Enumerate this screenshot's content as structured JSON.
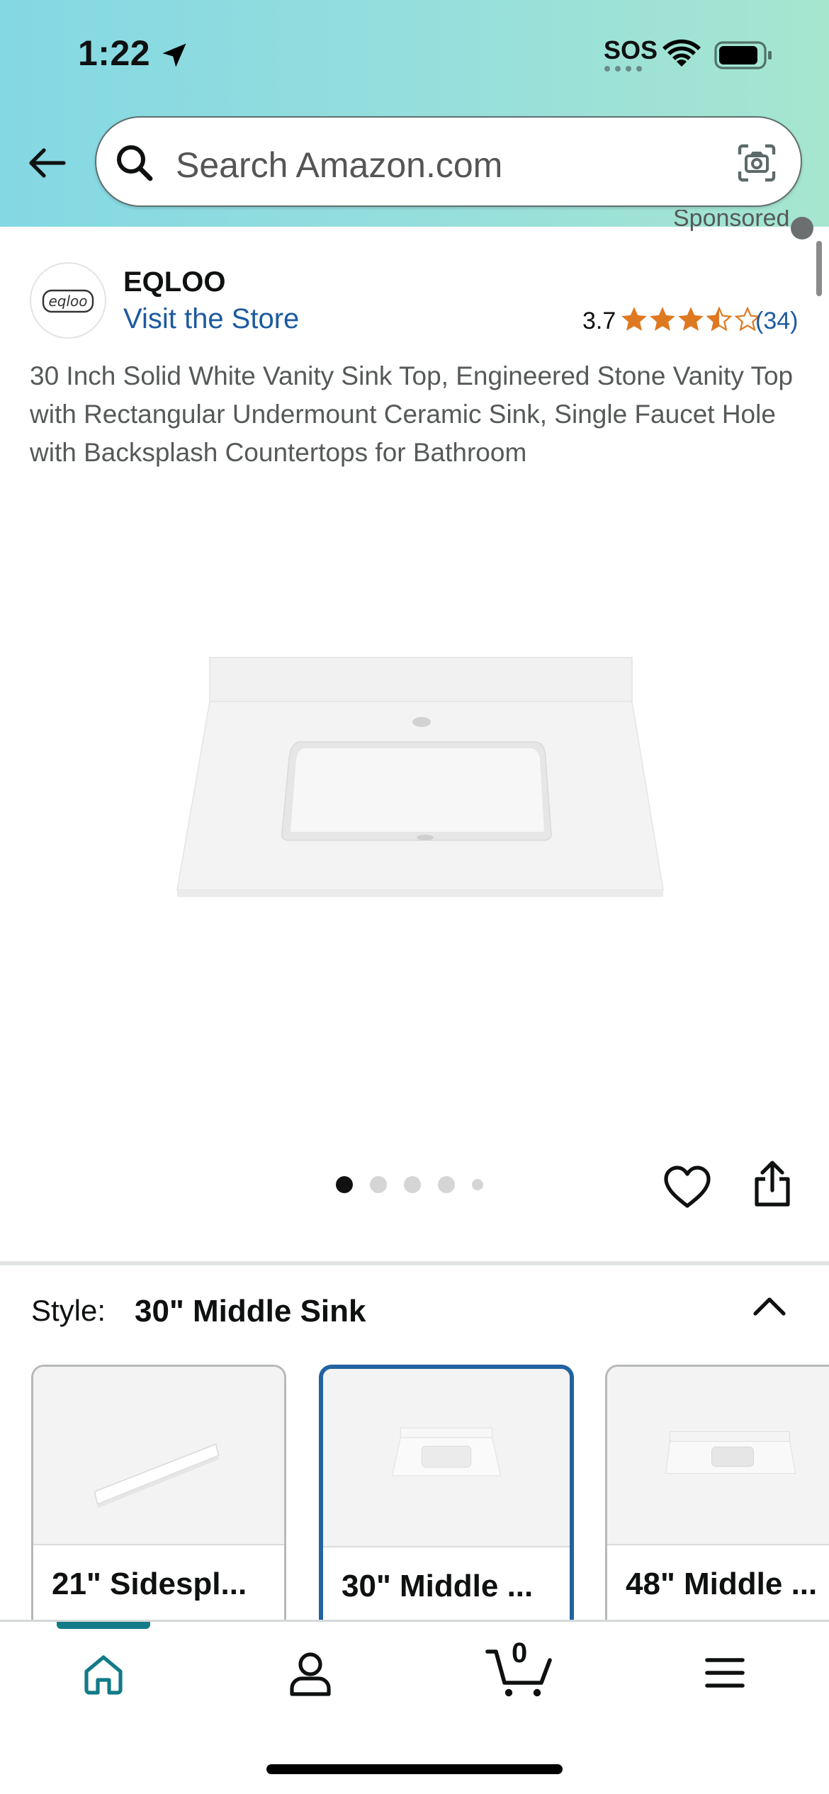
{
  "status_bar": {
    "time": "1:22",
    "sos": "SOS"
  },
  "search": {
    "placeholder": "Search Amazon.com"
  },
  "sponsored_label": "Sponsored",
  "brand": {
    "name": "EQLOO",
    "logo_text": "eqloo",
    "visit_store": "Visit the Store",
    "rating": "3.7",
    "rating_value": 3.7,
    "rating_count": "(34)"
  },
  "product": {
    "title": "30 Inch Solid White Vanity Sink Top, Engineered Stone Vanity Top with Rectangular Undermount Ceramic Sink, Single Faucet Hole with Backsplash Countertops for Bathroom"
  },
  "carousel": {
    "total_images": 5,
    "active_index": 0
  },
  "style_selector": {
    "label": "Style:",
    "selected": "30\" Middle Sink",
    "options": [
      {
        "label": "21\" Sidespl..."
      },
      {
        "label": "30\" Middle ..."
      },
      {
        "label": "48\" Middle ..."
      }
    ]
  },
  "nav": {
    "cart_count": "0"
  },
  "colors": {
    "accent_blue": "#2162a1",
    "link_blue": "#1d5aa0",
    "star_orange": "#de7921",
    "home_teal": "#137a88"
  }
}
